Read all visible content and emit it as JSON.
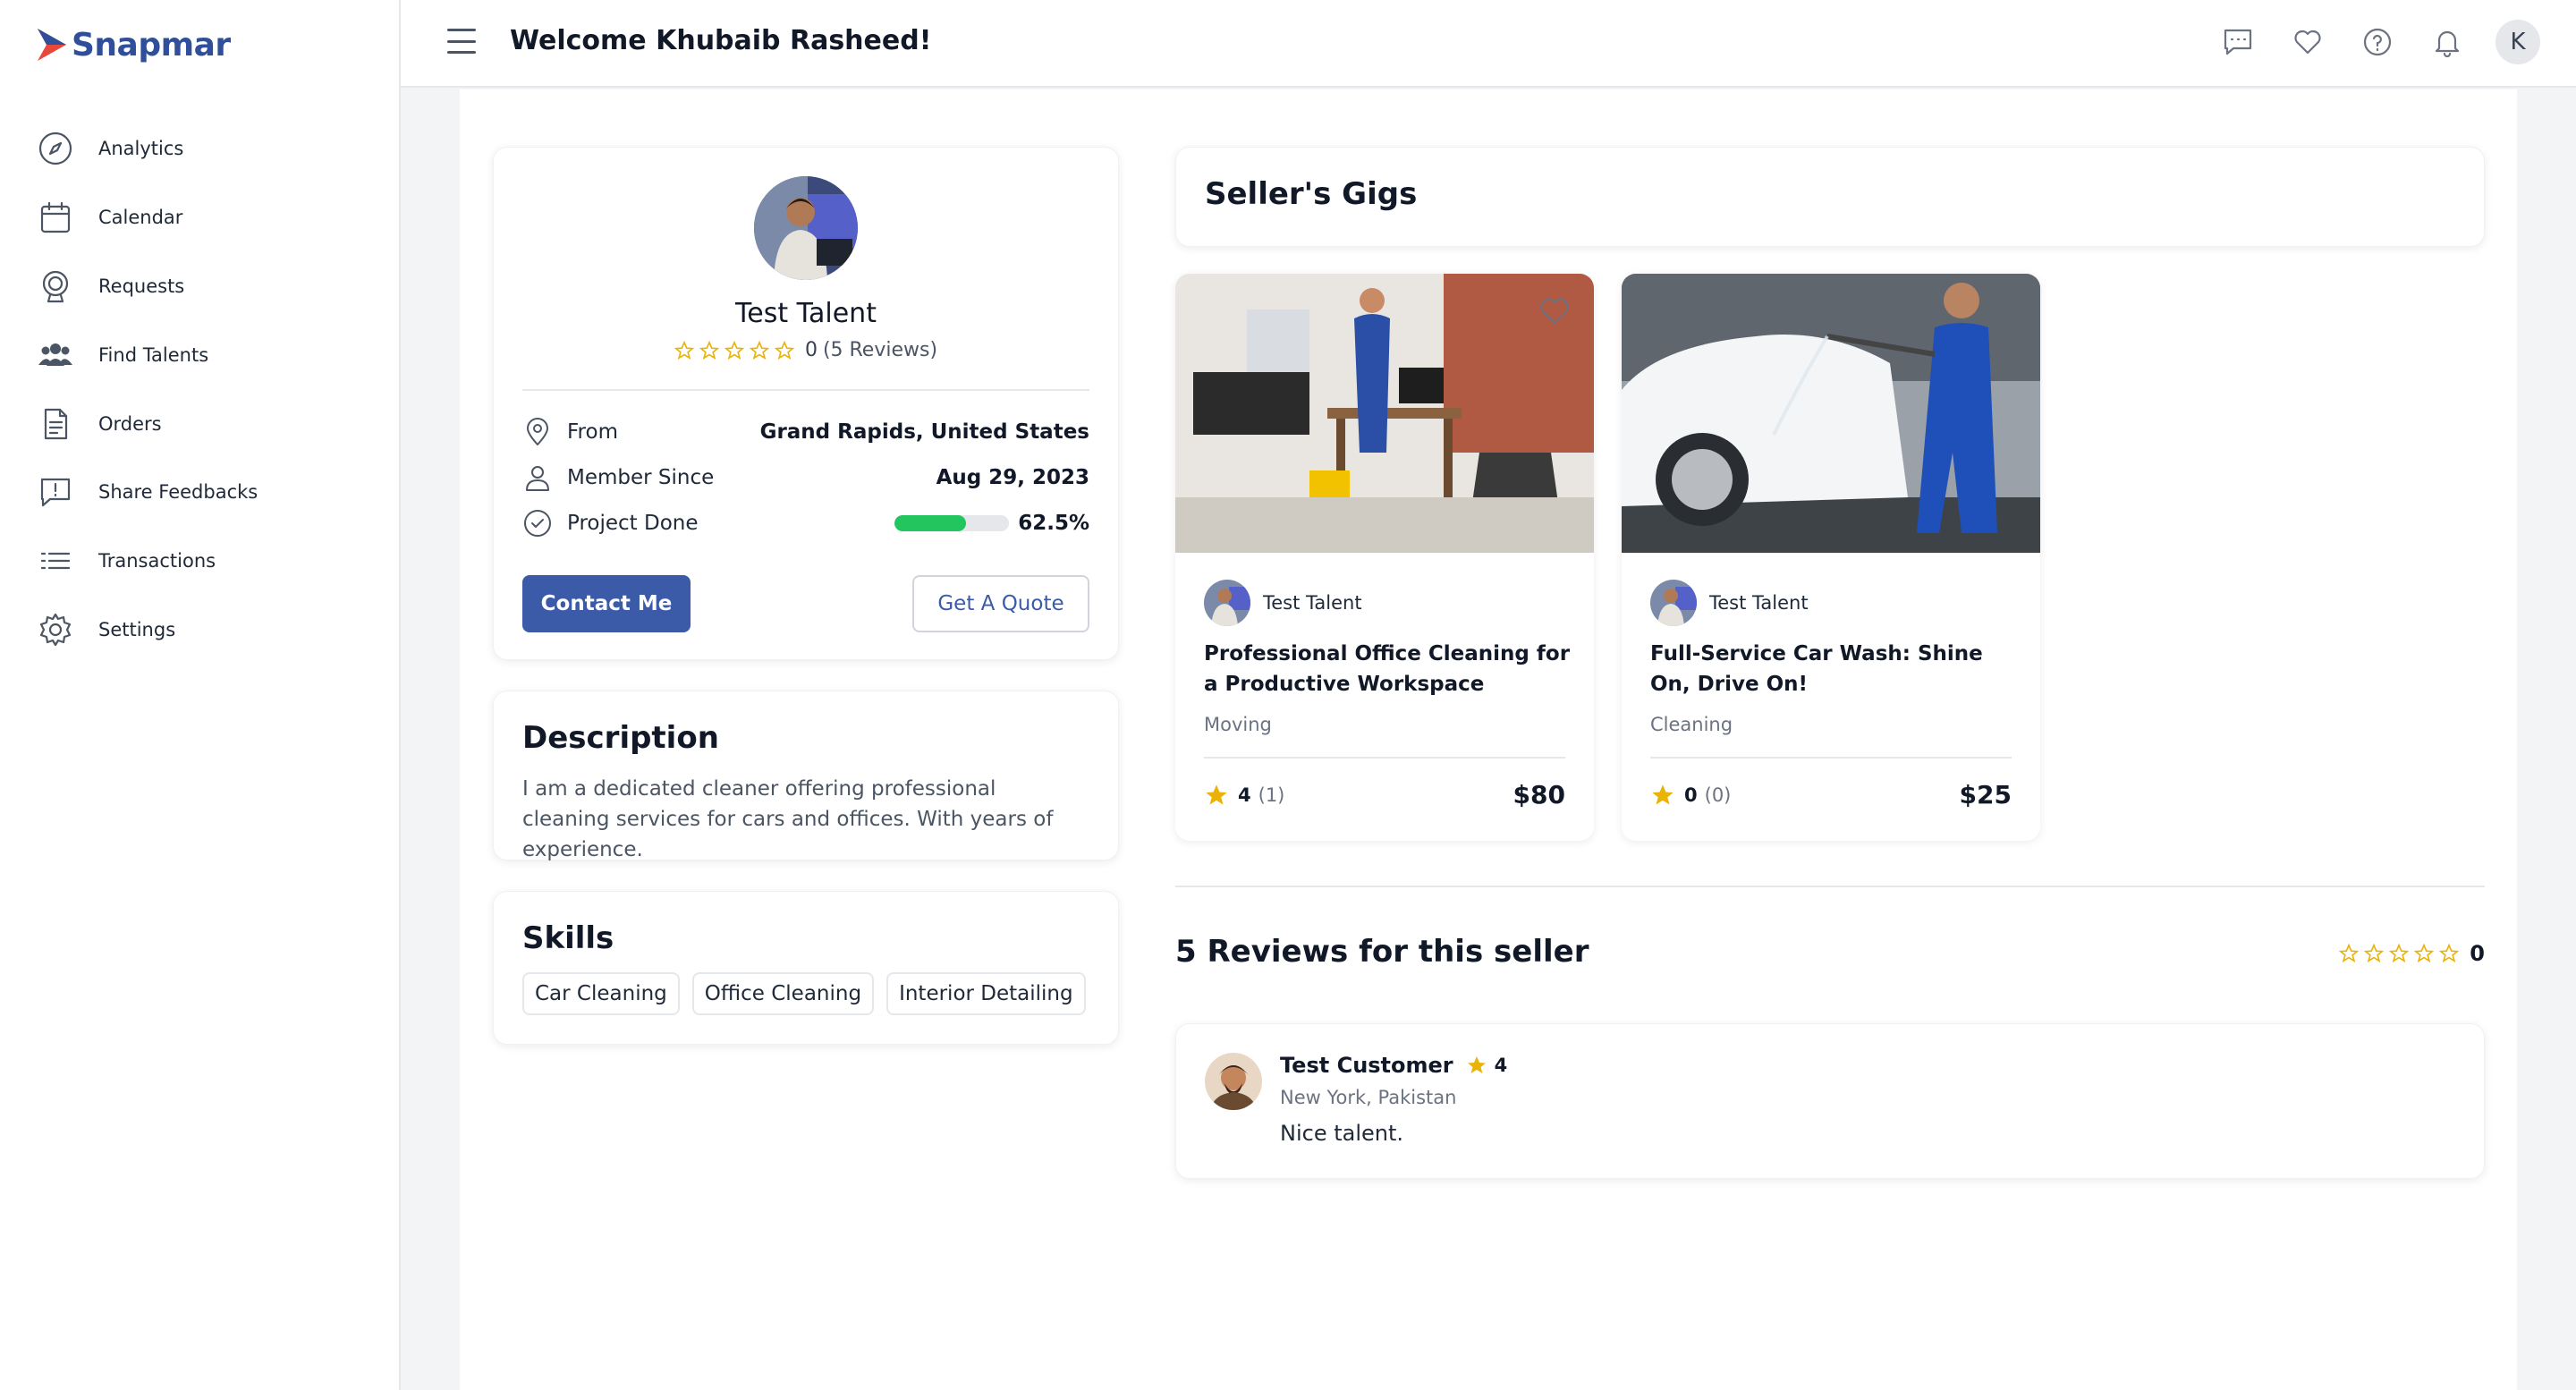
{
  "app": {
    "brand": "Snapmar"
  },
  "sidebar": {
    "items": [
      {
        "label": "Analytics",
        "icon": "compass-icon"
      },
      {
        "label": "Calendar",
        "icon": "calendar-icon"
      },
      {
        "label": "Requests",
        "icon": "requests-icon"
      },
      {
        "label": "Find Talents",
        "icon": "people-icon"
      },
      {
        "label": "Orders",
        "icon": "orders-icon"
      },
      {
        "label": "Share Feedbacks",
        "icon": "feedback-icon"
      },
      {
        "label": "Transactions",
        "icon": "list-icon"
      },
      {
        "label": "Settings",
        "icon": "gear-icon"
      }
    ]
  },
  "header": {
    "welcome": "Welcome Khubaib Rasheed!",
    "avatar_initial": "K"
  },
  "profile": {
    "name": "Test Talent",
    "rating": "0",
    "reviews": "(5 Reviews)",
    "from_label": "From",
    "from_value": "Grand Rapids, United States",
    "member_label": "Member Since",
    "member_value": "Aug 29, 2023",
    "project_label": "Project Done",
    "project_value": "62.5%",
    "project_fraction": 0.625,
    "contact_button": "Contact Me",
    "quote_button": "Get A Quote"
  },
  "description": {
    "title": "Description",
    "text": "I am a dedicated cleaner offering professional cleaning services for cars and offices. With years of experience."
  },
  "skills": {
    "title": "Skills",
    "items": [
      "Car Cleaning",
      "Office Cleaning",
      "Interior Detailing"
    ]
  },
  "gigs": {
    "title": "Seller's Gigs",
    "items": [
      {
        "seller": "Test Talent",
        "title": "Professional Office Cleaning for a Productive Workspace",
        "category": "Moving",
        "rating": "4",
        "count": "(1)",
        "price": "$80"
      },
      {
        "seller": "Test Talent",
        "title": "Full-Service Car Wash: Shine On, Drive On!",
        "category": "Cleaning",
        "rating": "0",
        "count": "(0)",
        "price": "$25"
      }
    ]
  },
  "reviews": {
    "title": "5 Reviews for this seller",
    "overall": "0",
    "items": [
      {
        "name": "Test Customer",
        "rating": "4",
        "location": "New York, Pakistan",
        "text": "Nice talent."
      }
    ]
  },
  "colors": {
    "brand": "#2f4f9a",
    "primary_button": "#3b5ba9",
    "progress": "#22c55e",
    "star": "#eab308"
  }
}
